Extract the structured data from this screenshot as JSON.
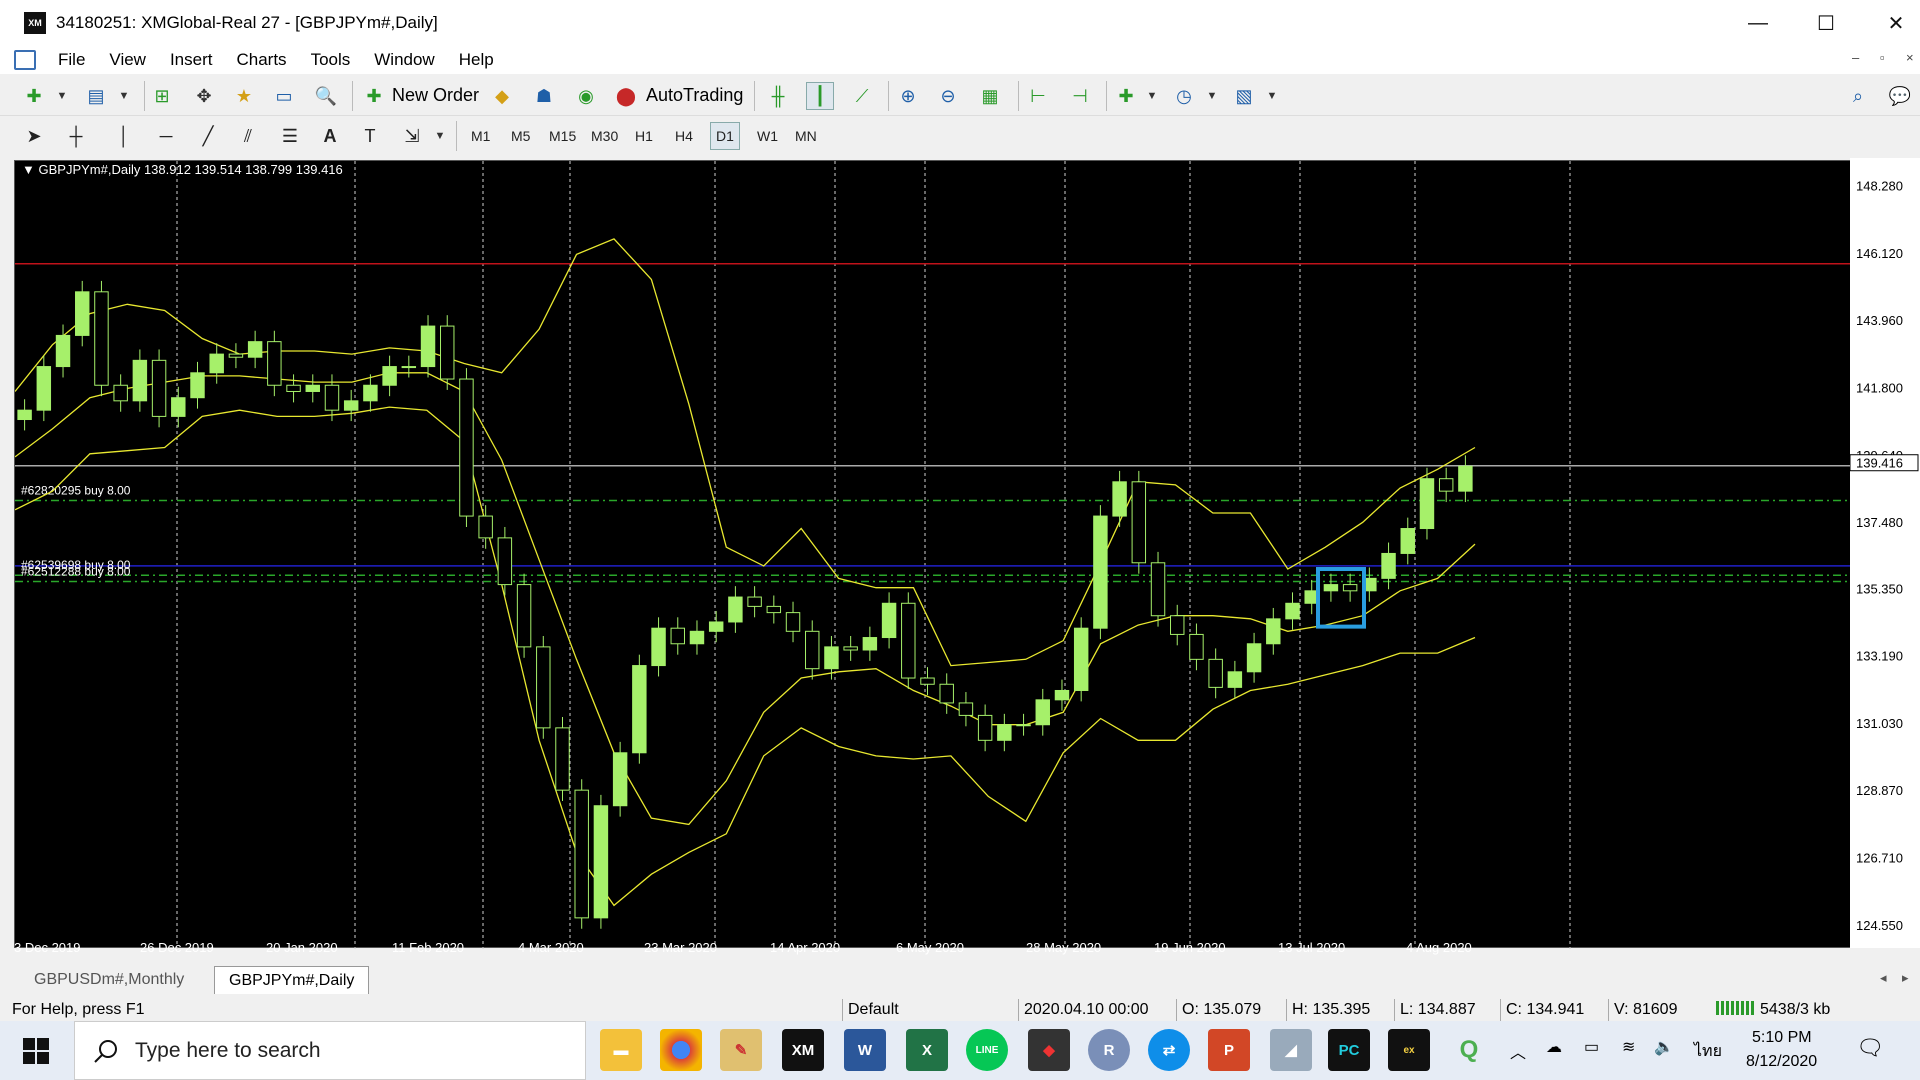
{
  "window": {
    "title": "34180251: XMGlobal-Real 27 - [GBPJPYm#,Daily]",
    "logo_text": "XM",
    "controls": {
      "minimize": "—",
      "maximize": "☐",
      "close": "✕"
    }
  },
  "menu": {
    "items": [
      "File",
      "View",
      "Insert",
      "Charts",
      "Tools",
      "Window",
      "Help"
    ],
    "mdi_controls": [
      "–",
      "▫",
      "×"
    ]
  },
  "toolbar": {
    "new_order_label": "New Order",
    "autotrading_label": "AutoTrading",
    "timeframes": [
      "M1",
      "M5",
      "M15",
      "M30",
      "H1",
      "H4",
      "D1",
      "W1",
      "MN"
    ],
    "active_timeframe": "D1",
    "draw_text_tool": "A"
  },
  "chart": {
    "header": "GBPJPYm#,Daily  138.912 139.514 138.799 139.416",
    "current_price": "139.416",
    "y_ticks": [
      "148.280",
      "146.120",
      "143.960",
      "141.800",
      "139.640",
      "137.480",
      "135.350",
      "133.190",
      "131.030",
      "128.870",
      "126.710",
      "124.550"
    ],
    "x_ticks": [
      "3 Dec 2019",
      "26 Dec 2019",
      "20 Jan 2020",
      "11 Feb 2020",
      "4 Mar 2020",
      "23 Mar 2020",
      "14 Apr 2020",
      "6 May 2020",
      "28 May 2020",
      "19 Jun 2020",
      "13 Jul 2020",
      "4 Aug 2020"
    ],
    "order_labels": [
      "#62820295 buy 8.00",
      "#62539698 buy 8.00",
      "#62512288 buy 8.00"
    ],
    "colors": {
      "background": "#000000",
      "candle": "#a6f06a",
      "bands": "#e8e830",
      "resistance": "#c0121a",
      "order_line": "#2aa72a",
      "blue_line": "#2020c8",
      "highlight": "#2a9ee0"
    }
  },
  "chart_data": {
    "type": "candlestick",
    "title": "GBPJPYm#,Daily",
    "ylim": [
      123.9,
      149.2
    ],
    "y_ticks": [
      148.28,
      146.12,
      143.96,
      141.8,
      139.64,
      137.48,
      135.35,
      133.19,
      131.03,
      128.87,
      126.71,
      124.55
    ],
    "horizontal_lines": [
      {
        "name": "resistance",
        "value": 145.9,
        "color": "#c0121a"
      },
      {
        "name": "current",
        "value": 139.416,
        "color": "#aaaaaa"
      },
      {
        "name": "order-62820295",
        "value": 138.3,
        "color": "#2aa72a"
      },
      {
        "name": "blue",
        "value": 136.2,
        "color": "#2020c8"
      },
      {
        "name": "order-62539698",
        "value": 135.9,
        "color": "#2aa72a"
      },
      {
        "name": "order-62512288",
        "value": 135.7,
        "color": "#2aa72a"
      }
    ],
    "close_path": [
      141.2,
      142.6,
      143.6,
      145.0,
      142.0,
      141.5,
      142.8,
      141.0,
      141.6,
      142.4,
      143.0,
      142.9,
      143.4,
      142.0,
      141.8,
      142.0,
      141.2,
      141.5,
      142.0,
      142.6,
      142.6,
      143.9,
      142.2,
      137.8,
      137.1,
      135.6,
      133.6,
      131.0,
      129.0,
      124.9,
      128.5,
      130.2,
      133.0,
      134.2,
      133.7,
      134.1,
      134.4,
      135.2,
      134.9,
      134.7,
      134.1,
      132.9,
      133.6,
      133.5,
      133.9,
      135.0,
      132.6,
      132.4,
      131.8,
      131.4,
      130.6,
      131.1,
      131.1,
      131.9,
      132.2,
      134.2,
      137.8,
      138.9,
      136.3,
      134.6,
      134.0,
      133.2,
      132.3,
      132.8,
      133.7,
      134.5,
      135.0,
      135.4,
      135.6,
      135.4,
      135.8,
      136.6,
      137.4,
      139.0,
      138.6,
      139.4
    ],
    "upper_band": [
      141.8,
      143.3,
      144.3,
      144.6,
      144.4,
      143.5,
      143.0,
      143.1,
      143.1,
      143.0,
      143.2,
      143.1,
      142.7,
      142.4,
      143.8,
      146.2,
      146.7,
      145.4,
      141.4,
      136.8,
      136.2,
      137.4,
      135.8,
      135.5,
      135.5,
      133.0,
      133.1,
      133.2,
      133.8,
      136.3,
      138.9,
      138.8,
      137.9,
      137.9,
      136.1,
      136.8,
      137.6,
      138.7,
      139.3,
      140.0
    ],
    "middle_band": [
      139.7,
      140.6,
      141.6,
      141.9,
      142.1,
      142.3,
      142.3,
      142.2,
      142.1,
      142.1,
      142.4,
      142.4,
      141.8,
      139.6,
      136.4,
      133.2,
      130.2,
      128.1,
      127.9,
      129.3,
      131.5,
      132.6,
      132.8,
      132.9,
      132.2,
      131.7,
      131.1,
      131.1,
      131.5,
      133.7,
      134.3,
      134.6,
      134.6,
      134.5,
      134.1,
      134.3,
      134.6,
      135.4,
      135.8,
      136.9
    ],
    "lower_band": [
      138.0,
      138.6,
      139.8,
      139.9,
      140.0,
      141.0,
      141.2,
      141.0,
      141.0,
      141.1,
      141.3,
      141.2,
      140.2,
      135.6,
      130.6,
      127.0,
      125.3,
      126.3,
      127.0,
      127.6,
      130.1,
      131.0,
      130.4,
      130.1,
      130.0,
      130.1,
      128.8,
      128.0,
      130.2,
      131.3,
      130.6,
      130.6,
      131.6,
      132.2,
      132.4,
      132.7,
      133.0,
      133.4,
      133.4,
      133.9
    ]
  },
  "tabs": [
    {
      "label": "GBPUSDm#,Monthly",
      "active": false
    },
    {
      "label": "GBPJPYm#,Daily",
      "active": true
    }
  ],
  "status": {
    "help": "For Help, press F1",
    "profile": "Default",
    "datetime": "2020.04.10 00:00",
    "open": "O: 135.079",
    "high": "H: 135.395",
    "low": "L: 134.887",
    "close": "C: 134.941",
    "volume": "V: 81609",
    "traffic": "5438/3 kb"
  },
  "taskbar": {
    "search_placeholder": "Type here to search",
    "apps": [
      "file-explorer",
      "chrome",
      "paint",
      "xm",
      "word",
      "excel",
      "line",
      "ea",
      "r",
      "teamviewer",
      "powerpoint",
      "tool",
      "pycharm",
      "exness",
      "qgis"
    ],
    "app_labels": {
      "xm": "XM",
      "word": "W",
      "excel": "X",
      "line": "LINE",
      "r": "R",
      "powerpoint": "P",
      "pycharm": "PC",
      "exness": "ex"
    },
    "lang": "ไทย",
    "time": "5:10 PM",
    "date": "8/12/2020"
  }
}
